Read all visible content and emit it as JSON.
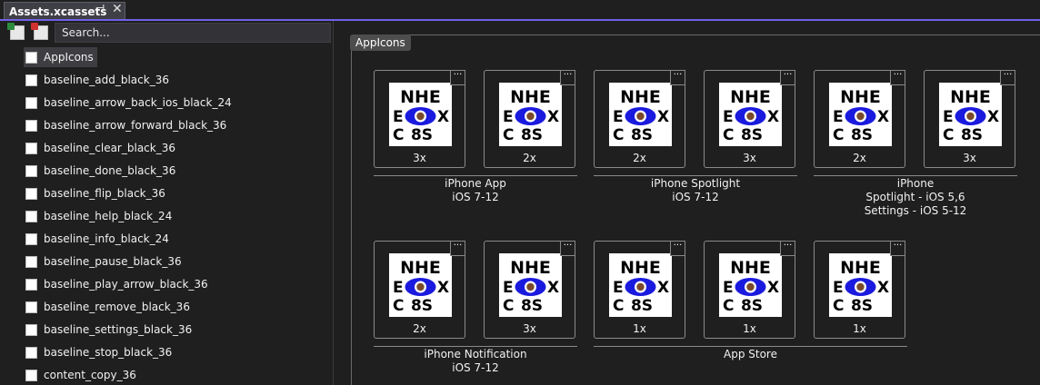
{
  "tab": {
    "title": "Assets.xcassets",
    "pin": "⊣",
    "close": "✕"
  },
  "search": {
    "placeholder": "Search..."
  },
  "assets": [
    {
      "label": "AppIcons",
      "selected": true
    },
    {
      "label": "baseline_add_black_36"
    },
    {
      "label": "baseline_arrow_back_ios_black_24"
    },
    {
      "label": "baseline_arrow_forward_black_36"
    },
    {
      "label": "baseline_clear_black_36"
    },
    {
      "label": "baseline_done_black_36"
    },
    {
      "label": "baseline_flip_black_36"
    },
    {
      "label": "baseline_help_black_24"
    },
    {
      "label": "baseline_info_black_24"
    },
    {
      "label": "baseline_pause_black_36"
    },
    {
      "label": "baseline_play_arrow_black_36"
    },
    {
      "label": "baseline_remove_black_36"
    },
    {
      "label": "baseline_settings_black_36"
    },
    {
      "label": "baseline_stop_black_36"
    },
    {
      "label": "content_copy_36"
    }
  ],
  "group": {
    "label": "AppIcons"
  },
  "icon_logo": {
    "line1": "NHE",
    "line2a": "E",
    "line2b": "X",
    "line3a": "C",
    "line3b": "8S"
  },
  "slots": [
    {
      "scale": "3x",
      "more": "···"
    },
    {
      "scale": "2x",
      "more": "···"
    },
    {
      "scale": "2x",
      "more": "···"
    },
    {
      "scale": "3x",
      "more": "···"
    },
    {
      "scale": "2x",
      "more": "···"
    },
    {
      "scale": "3x",
      "more": "···"
    },
    {
      "scale": "2x",
      "more": "···"
    },
    {
      "scale": "3x",
      "more": "···"
    },
    {
      "scale": "1x",
      "more": "···"
    },
    {
      "scale": "1x",
      "more": "···"
    },
    {
      "scale": "1x",
      "more": "···"
    }
  ],
  "captions": [
    {
      "line1": "iPhone App",
      "line2": "iOS 7-12",
      "line3": ""
    },
    {
      "line1": "iPhone Spotlight",
      "line2": "iOS 7-12",
      "line3": ""
    },
    {
      "line1": "iPhone",
      "line2": "Spotlight - iOS 5,6",
      "line3": "Settings - iOS 5-12"
    },
    {
      "line1": "iPhone Notification",
      "line2": "iOS 7-12",
      "line3": ""
    },
    {
      "line1": "App Store",
      "line2": "",
      "line3": ""
    }
  ],
  "colors": {
    "accent": "#7160e8",
    "eye": "#1a1adf",
    "pupil": "#7a4a2a"
  }
}
